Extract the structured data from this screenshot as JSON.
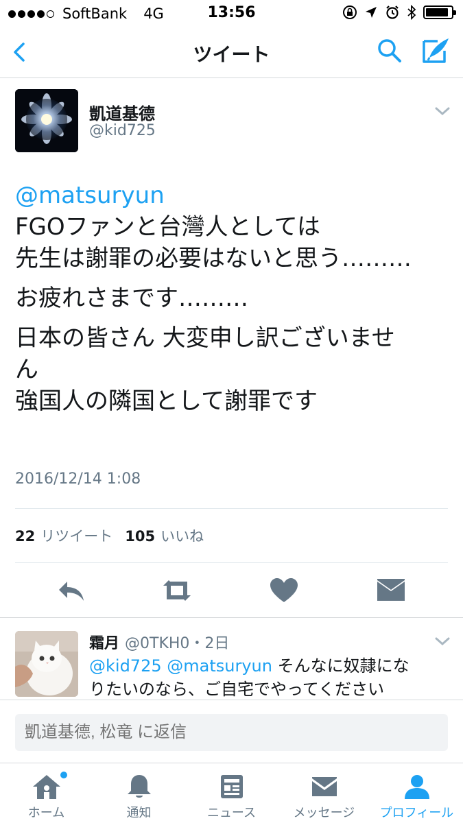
{
  "status_bar": {
    "carrier": "SoftBank",
    "network": "4G",
    "time": "13:56",
    "battery_level": 0.9
  },
  "nav": {
    "title": "ツイート",
    "back_icon": "chevron-left-icon",
    "search_icon": "search-icon",
    "compose_icon": "compose-icon"
  },
  "tweet": {
    "author_name": "凱道基德",
    "author_handle": "@kid725",
    "mention": "@matsuryun",
    "lines": [
      "FGOファンと台灣人としては",
      "先生は謝罪の必要はないと思う………",
      "お疲れさまです………",
      "日本の皆さん 大変申し訳ございませ",
      "ん",
      "強国人の隣国として謝罪です"
    ],
    "timestamp": "2016/12/14 1:08",
    "retweet_count": "22",
    "retweet_label": "リツイート",
    "like_count": "105",
    "like_label": "いいね"
  },
  "reply": {
    "name": "霜月",
    "handle_time": "@0TKH0・2日",
    "mentions": "@kid725 @matsuryun",
    "text_1": " そんなに奴隷にな",
    "text_2": "りたいのなら、ご自宅でやってください"
  },
  "reply_box": {
    "placeholder": "凱道基德, 松竜 に返信"
  },
  "tabs": [
    {
      "label": "ホーム",
      "icon": "home-icon"
    },
    {
      "label": "通知",
      "icon": "bell-icon"
    },
    {
      "label": "ニュース",
      "icon": "news-icon"
    },
    {
      "label": "メッセージ",
      "icon": "envelope-icon"
    },
    {
      "label": "プロフィール",
      "icon": "person-icon"
    }
  ],
  "colors": {
    "accent": "#1da1f2",
    "text": "#14171a",
    "muted": "#657786",
    "icon_gray": "#657786"
  }
}
